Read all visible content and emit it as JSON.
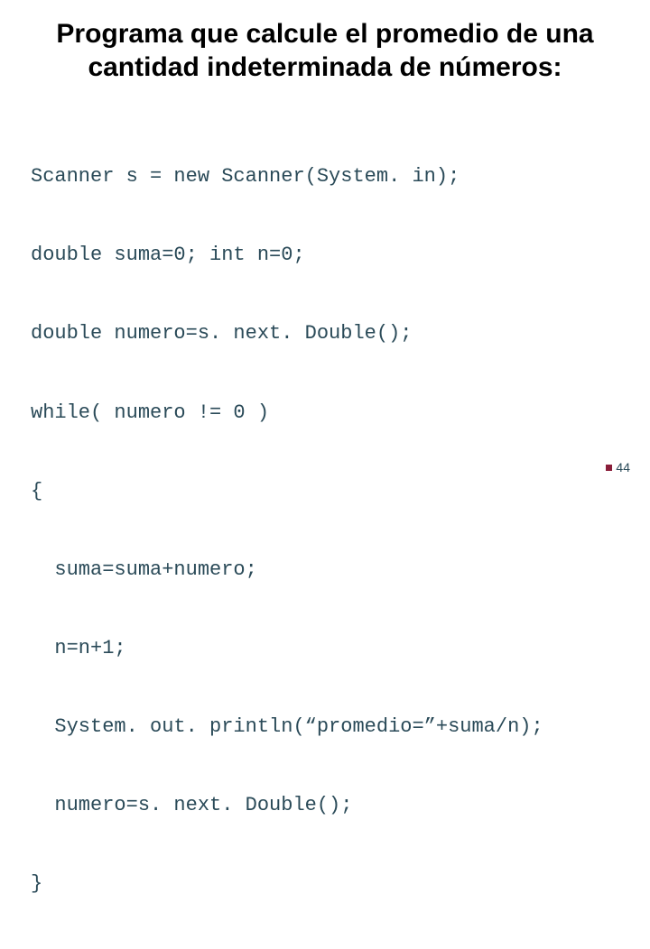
{
  "title": "Programa que calcule el promedio de una cantidad indeterminada de números:",
  "code_lines": [
    "Scanner s = new Scanner(System. in);",
    "double suma=0; int n=0;",
    "double numero=s. next. Double();",
    "while( numero != 0 )",
    "{",
    "  suma=suma+numero;",
    "  n=n+1;",
    "  System. out. println(“promedio=”+suma/n);",
    "  numero=s. next. Double();",
    "}"
  ],
  "page_number": "44"
}
